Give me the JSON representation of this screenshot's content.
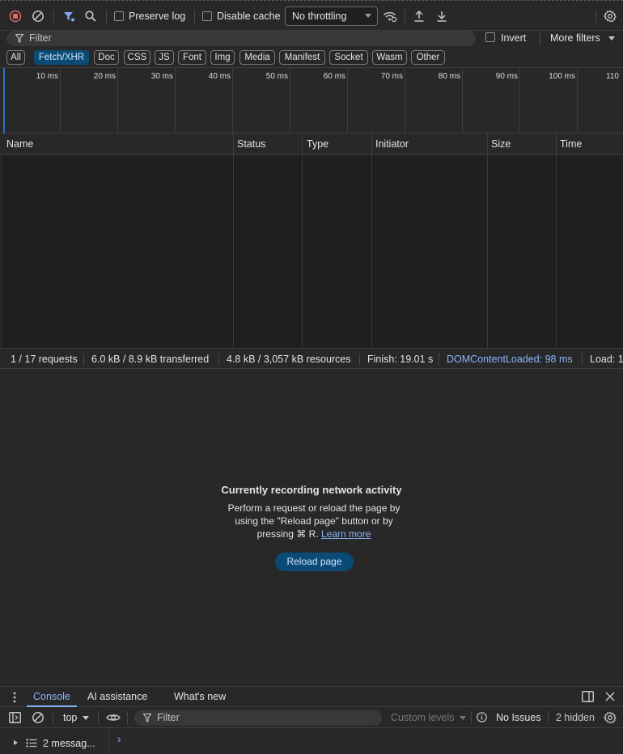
{
  "toolbar": {
    "preserve_log": "Preserve log",
    "disable_cache": "Disable cache",
    "throttling": "No throttling",
    "icons": [
      "record-stop-icon",
      "clear-icon",
      "filter-funnel-icon",
      "search-icon",
      "network-conditions-icon",
      "upload-icon",
      "download-icon",
      "settings-gear-icon"
    ]
  },
  "filter_bar": {
    "placeholder": "Filter",
    "invert": "Invert",
    "more_filters": "More filters"
  },
  "type_chips": [
    "All",
    "Fetch/XHR",
    "Doc",
    "CSS",
    "JS",
    "Font",
    "Img",
    "Media",
    "Manifest",
    "Socket",
    "Wasm",
    "Other"
  ],
  "active_chip": "Fetch/XHR",
  "timeline": {
    "ticks": [
      "10 ms",
      "20 ms",
      "30 ms",
      "40 ms",
      "50 ms",
      "60 ms",
      "70 ms",
      "80 ms",
      "90 ms",
      "100 ms",
      "110"
    ]
  },
  "table": {
    "columns": [
      "Name",
      "Status",
      "Type",
      "Initiator",
      "Size",
      "Time"
    ],
    "rows": []
  },
  "summary": {
    "requests": "1 / 17 requests",
    "transferred": "6.0 kB / 8.9 kB transferred",
    "resources": "4.8 kB / 3,057 kB resources",
    "finish": "Finish: 19.01 s",
    "dom_content_loaded": "DOMContentLoaded: 98 ms",
    "load": "Load: 1"
  },
  "empty_state": {
    "title": "Currently recording network activity",
    "line1": "Perform a request or reload the page by",
    "line2": "using the \"Reload page\" button or by",
    "line3_prefix": "pressing ⌘ R.",
    "learn_more": "Learn more",
    "reload_button": "Reload page"
  },
  "drawer": {
    "tabs": [
      "Console",
      "AI assistance",
      "What's new"
    ],
    "active_tab": "Console"
  },
  "console_toolbar": {
    "context": "top",
    "filter_placeholder": "Filter",
    "levels": "Custom levels",
    "issues": "No Issues",
    "hidden": "2 hidden"
  },
  "console_body": {
    "messages": "2 messag...",
    "prompt": "›"
  },
  "colors": {
    "background": "#282828",
    "accent": "#8ab4f8",
    "active_chip": "#0b4a75",
    "record": "#e46962"
  }
}
